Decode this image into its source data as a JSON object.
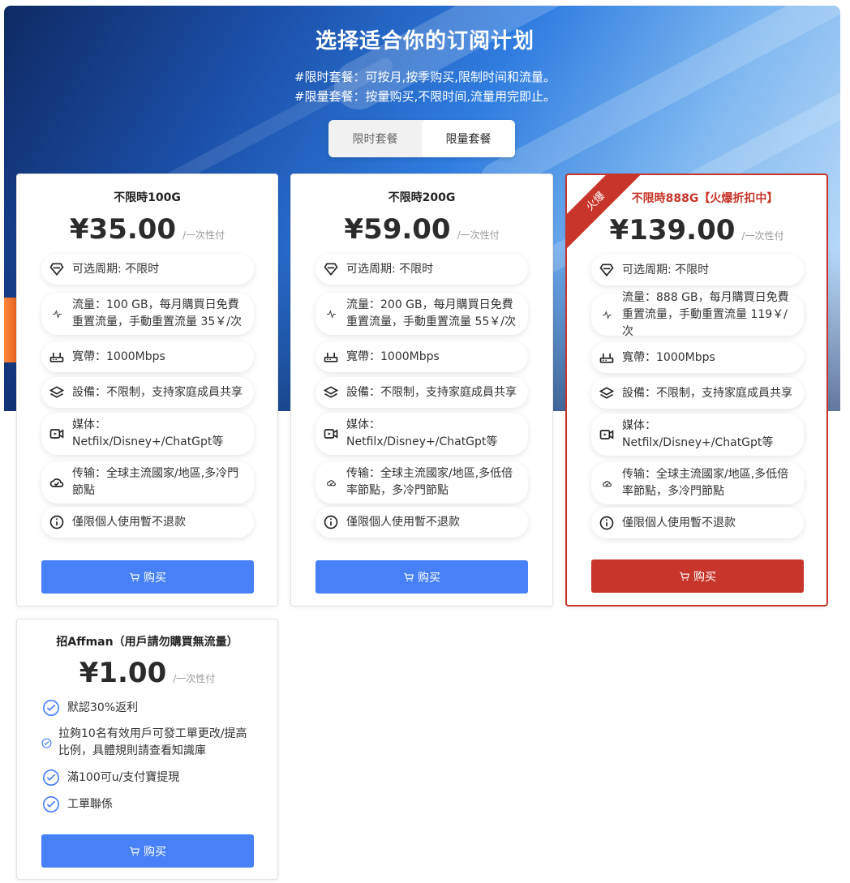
{
  "header": {
    "title": "选择适合你的订阅计划",
    "line1": "#限时套餐：可按月,按季购买,限制时间和流量。",
    "line2": "#限量套餐：按量购买,不限时间,流量用完即止。"
  },
  "tabs": {
    "time_limited": "限时套餐",
    "data_limited": "限量套餐",
    "active": "限量套餐"
  },
  "plans": [
    {
      "name": "不限時100G",
      "price": "¥35.00",
      "per": "/一次性付",
      "features": {
        "period": "可选周期: 不限时",
        "traffic": "流量：100 GB，每月購買日免費重置流量，手動重置流量 35￥/次",
        "bandwidth": "寬帶：1000Mbps",
        "device": "設備：不限制，支持家庭成員共享",
        "media": "媒体：Netfilx/Disney+/ChatGpt等",
        "transfer": "传输：全球主流國家/地區,多冷門節點",
        "notice": "僅限個人使用暫不退款"
      },
      "buy_label": "购买"
    },
    {
      "name": "不限時200G",
      "price": "¥59.00",
      "per": "/一次性付",
      "features": {
        "period": "可选周期: 不限时",
        "traffic": "流量：200 GB，每月購買日免費重置流量，手動重置流量 55￥/次",
        "bandwidth": "寬帶：1000Mbps",
        "device": "設備：不限制，支持家庭成員共享",
        "media": "媒体：Netfilx/Disney+/ChatGpt等",
        "transfer": "传输：全球主流國家/地區,多低倍率節點，多冷門節點",
        "notice": "僅限個人使用暫不退款"
      },
      "buy_label": "购买"
    },
    {
      "name": "不限時888G【火爆折扣中】",
      "badge": "火爆",
      "price": "¥139.00",
      "per": "/一次性付",
      "features": {
        "period": "可选周期: 不限时",
        "traffic": "流量：888 GB，每月購買日免費重置流量，手動重置流量 119￥/次",
        "bandwidth": "寬帶：1000Mbps",
        "device": "設備：不限制，支持家庭成員共享",
        "media": "媒体：Netfilx/Disney+/ChatGpt等",
        "transfer": "传输：全球主流國家/地區,多低倍率節點，多冷門節點",
        "notice": "僅限個人使用暫不退款"
      },
      "buy_label": "购买"
    }
  ],
  "affiliate": {
    "name": "招Affman（用戶請勿購買無流量）",
    "price": "¥1.00",
    "per": "/一次性付",
    "items": [
      "默認30%返利",
      "拉夠10名有效用戶可發工單更改/提高比例，具體規則請查看知識庫",
      "滿100可u/支付寶提現",
      "工單聯係"
    ],
    "buy_label": "购买"
  },
  "colors": {
    "accent": "#4880f7",
    "hot": "#c8352a"
  }
}
